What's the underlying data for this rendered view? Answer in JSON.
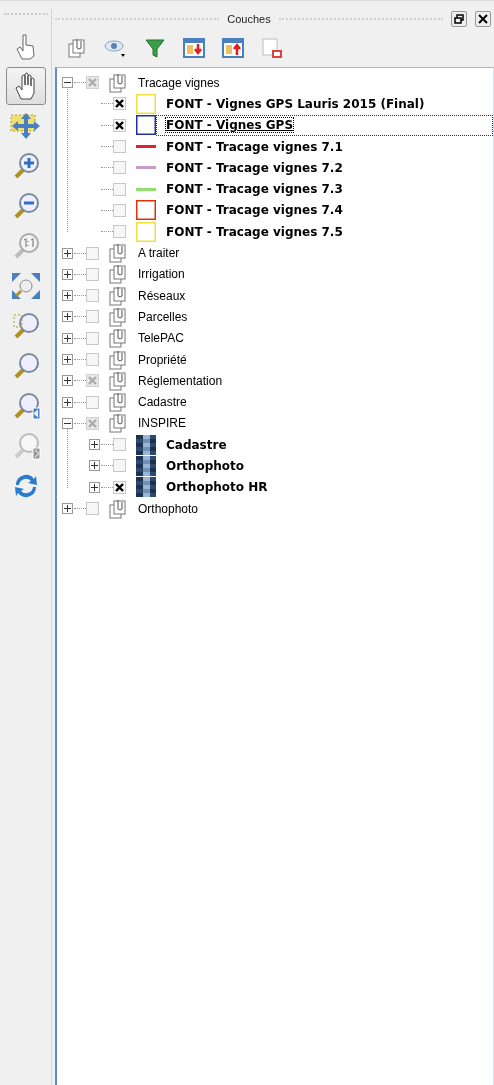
{
  "tools": [
    {
      "kind": "touch",
      "selected": false
    },
    {
      "kind": "pan",
      "selected": true
    },
    {
      "kind": "move",
      "selected": false
    },
    {
      "kind": "zoom-in",
      "selected": false
    },
    {
      "kind": "zoom-out",
      "selected": false
    },
    {
      "kind": "zoom-actual",
      "selected": false
    },
    {
      "kind": "zoom-full",
      "selected": false
    },
    {
      "kind": "zoom-selection",
      "selected": false
    },
    {
      "kind": "zoom-layer",
      "selected": false
    },
    {
      "kind": "zoom-last",
      "selected": false
    },
    {
      "kind": "zoom-next",
      "selected": false
    },
    {
      "kind": "refresh",
      "selected": false
    }
  ],
  "panel": {
    "title": "Couches"
  },
  "layers_toolbar": [
    {
      "kind": "add-group"
    },
    {
      "kind": "visibility"
    },
    {
      "kind": "filter"
    },
    {
      "kind": "expand"
    },
    {
      "kind": "collapse"
    },
    {
      "kind": "remove"
    }
  ],
  "tree": [
    {
      "kind": "group",
      "label": "Tracage vignes",
      "expanded": true,
      "checked": false,
      "partial": true,
      "children": [
        {
          "kind": "polygon",
          "label": "FONT - Vignes GPS Lauris 2015 (Final)",
          "checked": true,
          "selected": false,
          "color": "#f0e040"
        },
        {
          "kind": "polygon",
          "label": "FONT - Vignes GPS",
          "checked": true,
          "selected": true,
          "color": "#2030a0"
        },
        {
          "kind": "line",
          "label": "FONT - Tracage vignes 7.1",
          "checked": false,
          "selected": false,
          "color": "#e0202c"
        },
        {
          "kind": "line",
          "label": "FONT - Tracage vignes 7.2",
          "checked": false,
          "selected": false,
          "color": "#c89ac8"
        },
        {
          "kind": "line",
          "label": "FONT - Tracage vignes 7.3",
          "checked": false,
          "selected": false,
          "color": "#90e070"
        },
        {
          "kind": "polygon",
          "label": "FONT - Tracage vignes 7.4",
          "checked": false,
          "selected": false,
          "color": "#e03010"
        },
        {
          "kind": "polygon",
          "label": "FONT - Tracage vignes 7.5",
          "checked": false,
          "selected": false,
          "color": "#f0e040"
        }
      ]
    },
    {
      "kind": "group",
      "label": "A traiter",
      "expanded": false,
      "checked": false,
      "partial": false
    },
    {
      "kind": "group",
      "label": "Irrigation",
      "expanded": false,
      "checked": false,
      "partial": false
    },
    {
      "kind": "group",
      "label": "Réseaux",
      "expanded": false,
      "checked": false,
      "partial": false
    },
    {
      "kind": "group",
      "label": "Parcelles",
      "expanded": false,
      "checked": false,
      "partial": false
    },
    {
      "kind": "group",
      "label": "TelePAC",
      "expanded": false,
      "checked": false,
      "partial": false
    },
    {
      "kind": "group",
      "label": "Propriété",
      "expanded": false,
      "checked": false,
      "partial": false
    },
    {
      "kind": "group",
      "label": "Réglementation",
      "expanded": false,
      "checked": false,
      "partial": true
    },
    {
      "kind": "group",
      "label": "Cadastre",
      "expanded": false,
      "checked": false,
      "partial": false
    },
    {
      "kind": "group",
      "label": "INSPIRE",
      "expanded": true,
      "checked": false,
      "partial": true,
      "children": [
        {
          "kind": "raster",
          "label": "Cadastre",
          "checked": false,
          "selected": false,
          "expanded": false
        },
        {
          "kind": "raster",
          "label": "Orthophoto",
          "checked": false,
          "selected": false,
          "expanded": false
        },
        {
          "kind": "raster",
          "label": "Orthophoto HR",
          "checked": true,
          "selected": false,
          "expanded": false
        }
      ]
    },
    {
      "kind": "group",
      "label": "Orthophoto",
      "expanded": false,
      "checked": false,
      "partial": false
    }
  ]
}
